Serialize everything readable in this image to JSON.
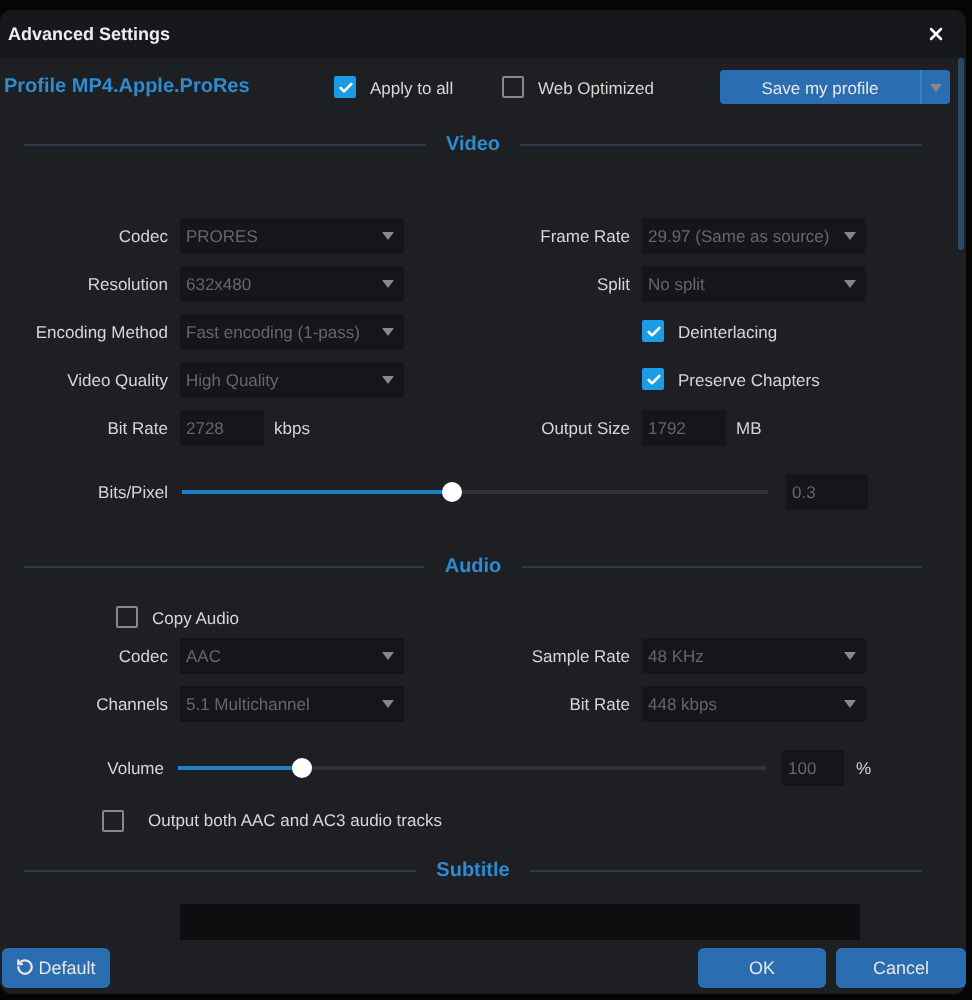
{
  "window": {
    "title": "Advanced Settings"
  },
  "profile": {
    "name": "Profile MP4.Apple.ProRes",
    "options": [
      {
        "label": "Apply to all",
        "checked": true
      },
      {
        "label": "Web Optimized",
        "checked": false
      }
    ],
    "save_button": "Save my profile"
  },
  "video": {
    "title": "Video",
    "rows": [
      {
        "left": {
          "kind": "select",
          "label": "Codec",
          "value": "PRORES"
        },
        "right": {
          "kind": "select",
          "label": "Frame Rate",
          "value": "29.97 (Same as source)"
        }
      },
      {
        "left": {
          "kind": "select",
          "label": "Resolution",
          "value": "632x480"
        },
        "right": {
          "kind": "select",
          "label": "Split",
          "value": "No split"
        }
      },
      {
        "left": {
          "kind": "select",
          "label": "Encoding Method",
          "value": "Fast encoding (1-pass)"
        },
        "right": {
          "kind": "checkbox",
          "label": "Deinterlacing",
          "checked": true
        }
      },
      {
        "left": {
          "kind": "select",
          "label": "Video Quality",
          "value": "High Quality"
        },
        "right": {
          "kind": "checkbox",
          "label": "Preserve Chapters",
          "checked": true
        }
      },
      {
        "left": {
          "kind": "number",
          "label": "Bit Rate",
          "value": "2728",
          "unit": "kbps"
        },
        "right": {
          "kind": "number",
          "label": "Output Size",
          "value": "1792",
          "unit": "MB"
        }
      }
    ],
    "slider": {
      "label": "Bits/Pixel",
      "level": 0.46,
      "value": "0.3"
    }
  },
  "audio": {
    "title": "Audio",
    "copy_audio": {
      "label": "Copy Audio",
      "checked": false
    },
    "rows": [
      {
        "left": {
          "kind": "select",
          "label": "Codec",
          "value": "AAC"
        },
        "right": {
          "kind": "select",
          "label": "Sample Rate",
          "value": "48 KHz"
        }
      },
      {
        "left": {
          "kind": "select",
          "label": "Channels",
          "value": "5.1 Multichannel"
        },
        "right": {
          "kind": "select",
          "label": "Bit Rate",
          "value": "448 kbps"
        }
      }
    ],
    "slider": {
      "label": "Volume",
      "level": 0.21,
      "value": "100",
      "unit": "%"
    },
    "output_both": {
      "label": "Output both AAC and AC3 audio tracks",
      "checked": false
    }
  },
  "subtitle": {
    "title": "Subtitle"
  },
  "footer": {
    "default_button": "Default",
    "ok_button": "OK",
    "cancel_button": "Cancel"
  }
}
